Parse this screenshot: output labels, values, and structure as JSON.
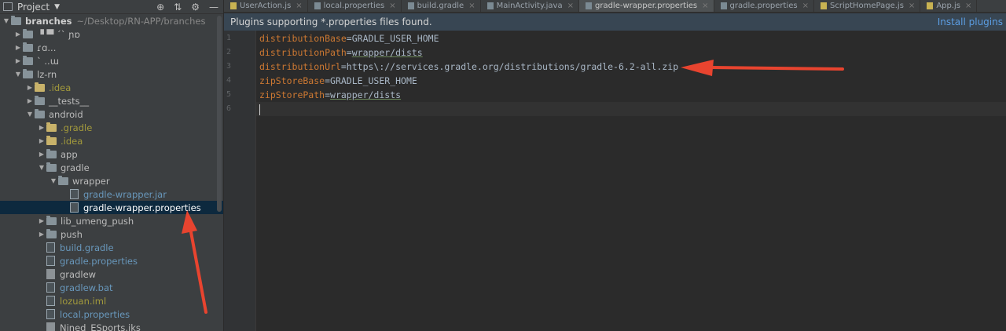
{
  "sidebar": {
    "header_label": "Project",
    "tree": [
      {
        "indent": 0,
        "arrow": "down",
        "icon": "folder",
        "label": "branches",
        "bold": true,
        "path": "~/Desktop/RN-APP/branches"
      },
      {
        "indent": 1,
        "arrow": "right",
        "icon": "folder",
        "label": "▝  ▀ ˊˋ ɲɒ"
      },
      {
        "indent": 1,
        "arrow": "right",
        "icon": "folder",
        "label": "ɾɑ..."
      },
      {
        "indent": 1,
        "arrow": "right",
        "icon": "folder",
        "label": "ˋ  ..ɯ"
      },
      {
        "indent": 1,
        "arrow": "down",
        "icon": "folder",
        "label": "lz-rn"
      },
      {
        "indent": 2,
        "arrow": "right",
        "icon": "folder-yellow",
        "label": ".idea",
        "color": "yellow"
      },
      {
        "indent": 2,
        "arrow": "right",
        "icon": "folder",
        "label": "__tests__"
      },
      {
        "indent": 2,
        "arrow": "down",
        "icon": "folder",
        "label": "android"
      },
      {
        "indent": 3,
        "arrow": "right",
        "icon": "folder-yellow",
        "label": ".gradle",
        "color": "yellow"
      },
      {
        "indent": 3,
        "arrow": "right",
        "icon": "folder-yellow",
        "label": ".idea",
        "color": "yellow"
      },
      {
        "indent": 3,
        "arrow": "right",
        "icon": "folder",
        "label": "app"
      },
      {
        "indent": 3,
        "arrow": "down",
        "icon": "folder",
        "label": "gradle"
      },
      {
        "indent": 4,
        "arrow": "down",
        "icon": "folder",
        "label": "wrapper"
      },
      {
        "indent": 5,
        "arrow": "",
        "icon": "file",
        "label": "gradle-wrapper.jar",
        "color": "blue"
      },
      {
        "indent": 5,
        "arrow": "",
        "icon": "file",
        "label": "gradle-wrapper.properties",
        "color": "sel",
        "selected": true
      },
      {
        "indent": 3,
        "arrow": "right",
        "icon": "folder",
        "label": "lib_umeng_push"
      },
      {
        "indent": 3,
        "arrow": "right",
        "icon": "folder",
        "label": "push"
      },
      {
        "indent": 3,
        "arrow": "",
        "icon": "file",
        "label": "build.gradle",
        "color": "blue"
      },
      {
        "indent": 3,
        "arrow": "",
        "icon": "file",
        "label": "gradle.properties",
        "color": "blue"
      },
      {
        "indent": 3,
        "arrow": "",
        "icon": "file-plain",
        "label": "gradlew"
      },
      {
        "indent": 3,
        "arrow": "",
        "icon": "file",
        "label": "gradlew.bat",
        "color": "blue"
      },
      {
        "indent": 3,
        "arrow": "",
        "icon": "file",
        "label": "lozuan.iml",
        "color": "yellow"
      },
      {
        "indent": 3,
        "arrow": "",
        "icon": "file",
        "label": "local.properties",
        "color": "blue"
      },
      {
        "indent": 3,
        "arrow": "",
        "icon": "file-plain",
        "label": "Nined_ESports.jks"
      }
    ]
  },
  "tabs": [
    {
      "label": "UserAction.js",
      "icon": "js"
    },
    {
      "label": "local.properties",
      "icon": "prop"
    },
    {
      "label": "build.gradle",
      "icon": "prop"
    },
    {
      "label": "MainActivity.java",
      "icon": "prop"
    },
    {
      "label": "gradle-wrapper.properties",
      "icon": "prop",
      "active": true
    },
    {
      "label": "gradle.properties",
      "icon": "prop"
    },
    {
      "label": "ScriptHomePage.js",
      "icon": "js"
    },
    {
      "label": "App.js",
      "icon": "js"
    }
  ],
  "banner": {
    "message": "Plugins supporting *.properties files found.",
    "action": "Install plugins"
  },
  "editor": {
    "lines": [
      {
        "num": "1",
        "key": "distributionBase",
        "value": "GRADLE_USER_HOME"
      },
      {
        "num": "2",
        "key": "distributionPath",
        "value": "wrapper/dists"
      },
      {
        "num": "3",
        "key": "distributionUrl",
        "value": "https\\://services.gradle.org/distributions/gradle-6.2-all.zip"
      },
      {
        "num": "4",
        "key": "zipStoreBase",
        "value": "GRADLE_USER_HOME"
      },
      {
        "num": "5",
        "key": "zipStorePath",
        "value": "wrapper/dists"
      },
      {
        "num": "6",
        "key": "",
        "value": "",
        "current": true
      }
    ]
  },
  "colors": {
    "annotation_arrow": "#e8442f",
    "accent": "#4a88c7"
  }
}
